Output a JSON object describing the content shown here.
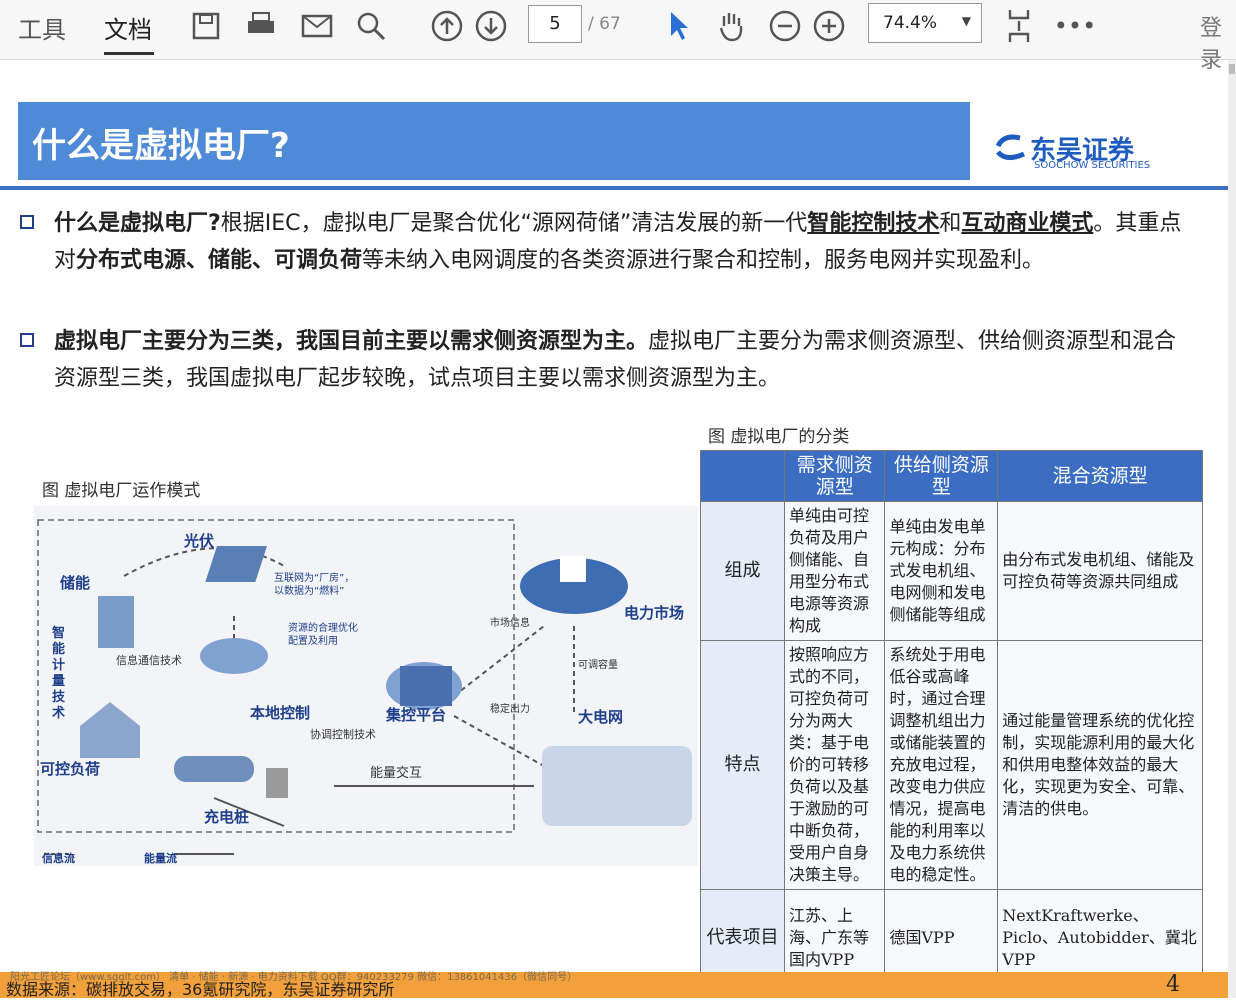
{
  "toolbar": {
    "tab_tools": "工具",
    "tab_document": "文档",
    "page_current": "5",
    "page_total": "/ 67",
    "zoom": "74.4%",
    "login": "登录"
  },
  "slide": {
    "title": "什么是虚拟电厂?",
    "logo_name": "东吴证券",
    "logo_en": "SOOCHOW SECURITIES",
    "p1": {
      "lead": "什么是虚拟电厂?",
      "t1": "根据IEC，虚拟电厂是聚合优化“源网荷储”清洁发展的新一代",
      "b1": "智能控制技术",
      "t2": "和",
      "b2": "互动商业模式",
      "t3": "。其重点对",
      "b3": "分布式电源、储能、可调负荷",
      "t4": "等未纳入电网调度的各类资源进行聚合和控制，服务电网并实现盈利。"
    },
    "p2": {
      "lead": "虚拟电厂主要分为三类，我国目前主要以需求侧资源型为主。",
      "rest": "虚拟电厂主要分为需求侧资源型、供给侧资源型和混合资源型三类，我国虚拟电厂起步较晚，试点项目主要以需求侧资源型为主。"
    },
    "fig_left_caption": "图  虚拟电厂运作模式",
    "fig_right_caption": "图  虚拟电厂的分类",
    "diagram": {
      "pv": "光伏",
      "storage": "储能",
      "smart_meter": "智能计量技术",
      "controllable_load": "可控负荷",
      "charger": "充电桩",
      "info_tech": "信息通信技术",
      "internet_factory": "互联网为“厂房”，以数据为“燃料”",
      "resource_opt": "资源的合理优化配置及利用",
      "local_control": "本地控制",
      "coord_tech": "协调控制技术",
      "platform": "集控平台",
      "market_info": "市场信息",
      "stable_output": "稳定出力",
      "power_market": "电力市场",
      "adjustable_capacity": "可调容量",
      "grid": "大电网",
      "energy_exchange": "能量交互",
      "info_flow": "信息流",
      "energy_flow": "能量流"
    },
    "table": {
      "headers": [
        "需求侧资源型",
        "供给侧资源型",
        "混合资源型"
      ],
      "rows": [
        {
          "label": "组成",
          "cells": [
            "单纯由可控负荷及用户侧储能、自用型分布式电源等资源构成",
            "单纯由发电单元构成：分布式发电机组、电网侧和发电侧储能等组成",
            "由分布式发电机组、储能及可控负荷等资源共同组成"
          ]
        },
        {
          "label": "特点",
          "cells": [
            "按照响应方式的不同，可控负荷可分为两大类：基于电价的可转移负荷以及基于激励的可中断负荷，受用户自身决策主导。",
            "系统处于用电低谷或高峰时，通过合理调整机组出力或储能装置的充放电过程，改变电力供应情况，提高电能的利用率以及电力系统供电的稳定性。",
            "通过能量管理系统的优化控制，实现能源利用的最大化和供用电整体效益的最大化，实现更为安全、可靠、清洁的供电。"
          ]
        },
        {
          "label": "代表项目",
          "cells": [
            "江苏、上海、广东等国内VPP",
            "德国VPP",
            "NextKraftwerke、Piclo、Autobidder、冀北VPP"
          ]
        }
      ]
    },
    "source": "数据来源：碳排放交易，36氪研究院，东吴证券研究所",
    "watermark_line": "阳光工匠论坛（www.sgglt.com）  清单 · 储能 · 新源 · 电力资料下载    QQ群：940233279      微信：13861041436（微信同号）",
    "page_no": "4"
  }
}
